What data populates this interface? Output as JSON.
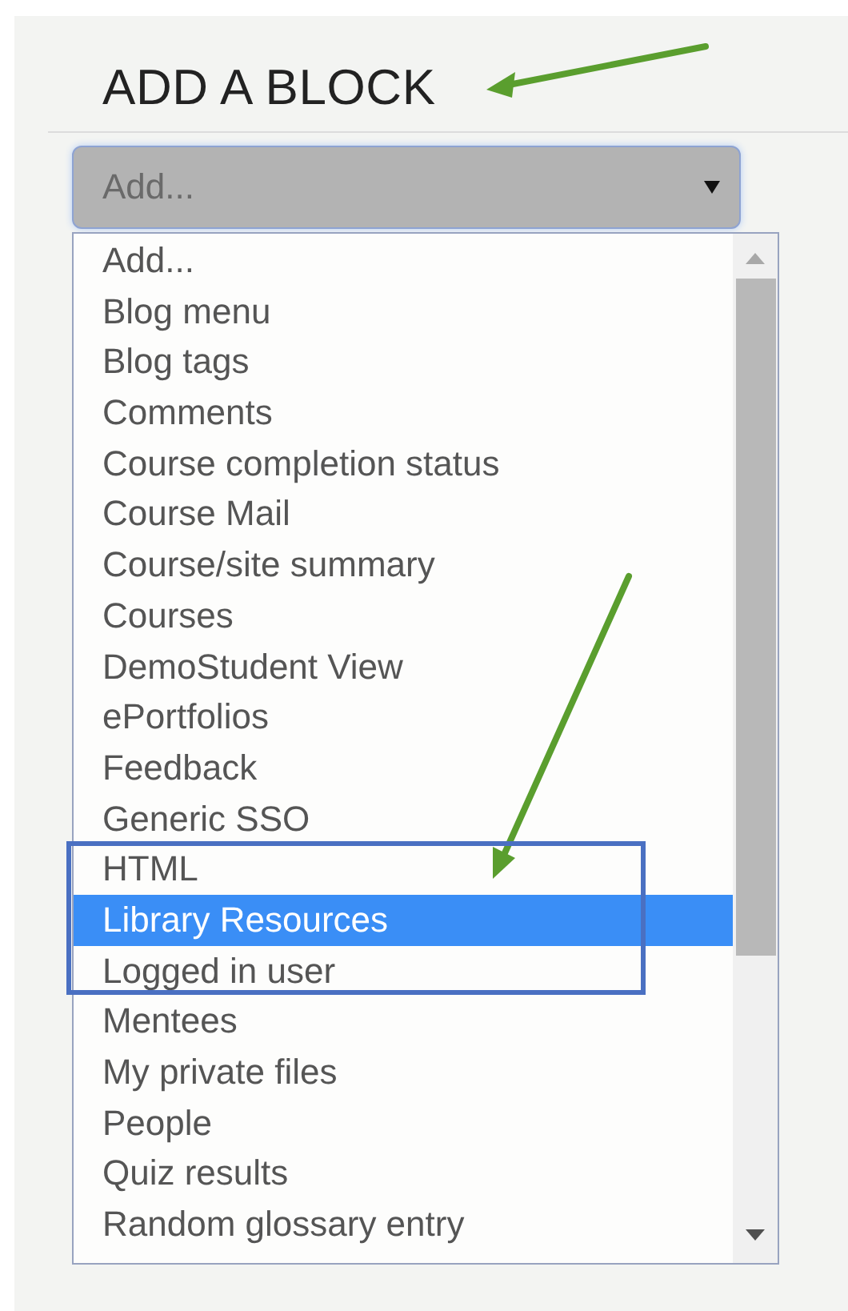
{
  "block": {
    "title": "ADD A BLOCK",
    "select": {
      "value": "Add..."
    },
    "options": [
      {
        "label": "Add...",
        "selected": false
      },
      {
        "label": "Blog menu",
        "selected": false
      },
      {
        "label": "Blog tags",
        "selected": false
      },
      {
        "label": "Comments",
        "selected": false
      },
      {
        "label": "Course completion status",
        "selected": false
      },
      {
        "label": "Course Mail",
        "selected": false
      },
      {
        "label": "Course/site summary",
        "selected": false
      },
      {
        "label": "Courses",
        "selected": false
      },
      {
        "label": "DemoStudent View",
        "selected": false
      },
      {
        "label": "ePortfolios",
        "selected": false
      },
      {
        "label": "Feedback",
        "selected": false
      },
      {
        "label": "Generic SSO",
        "selected": false
      },
      {
        "label": "HTML",
        "selected": false
      },
      {
        "label": "Library Resources",
        "selected": true
      },
      {
        "label": "Logged in user",
        "selected": false
      },
      {
        "label": "Mentees",
        "selected": false
      },
      {
        "label": "My private files",
        "selected": false
      },
      {
        "label": "People",
        "selected": false
      },
      {
        "label": "Quiz results",
        "selected": false
      },
      {
        "label": "Random glossary entry",
        "selected": false
      }
    ]
  }
}
